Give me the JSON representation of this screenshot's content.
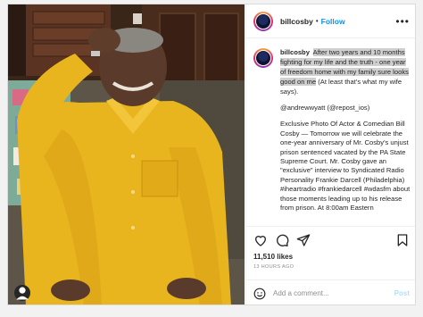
{
  "post": {
    "username": "billcosby",
    "follow_label": "Follow",
    "caption_user": "billcosby",
    "caption_highlight": "After two years and 10 months fighting for my life and the truth - one year of freedom home with my family sure looks good on me",
    "caption_tail": "(At least that's what my wife says).",
    "credit": "@andrewwyatt (@repost_ios)",
    "body": "Exclusive Photo Of Actor & Comedian Bill Cosby — Tomorrow we will celebrate the one-year anniversary of Mr. Cosby's unjust prison sentenced vacated by the PA State Supreme Court. Mr. Cosby gave an \"exclusive\" interview to Syndicated Radio Personality Frankie Darcell (Philadelphia) #iheartradio #frankiedarcell #wdasfm about those moments leading up to his release from prison. At 8:00am Eastern",
    "likes": "11,510 likes",
    "time": "13 HOURS AGO",
    "comment_placeholder": "Add a comment...",
    "post_label": "Post"
  },
  "icons": {
    "more": "more-horizontal-icon",
    "like": "heart-icon",
    "comment": "comment-icon",
    "share": "paper-plane-icon",
    "save": "bookmark-icon",
    "emoji": "smiley-icon",
    "tag": "user-tag-icon"
  },
  "colors": {
    "follow": "#0095f6",
    "post_disabled": "#b2dffc",
    "highlight": "#cfcfcf",
    "shirt": "#e8b21c"
  }
}
